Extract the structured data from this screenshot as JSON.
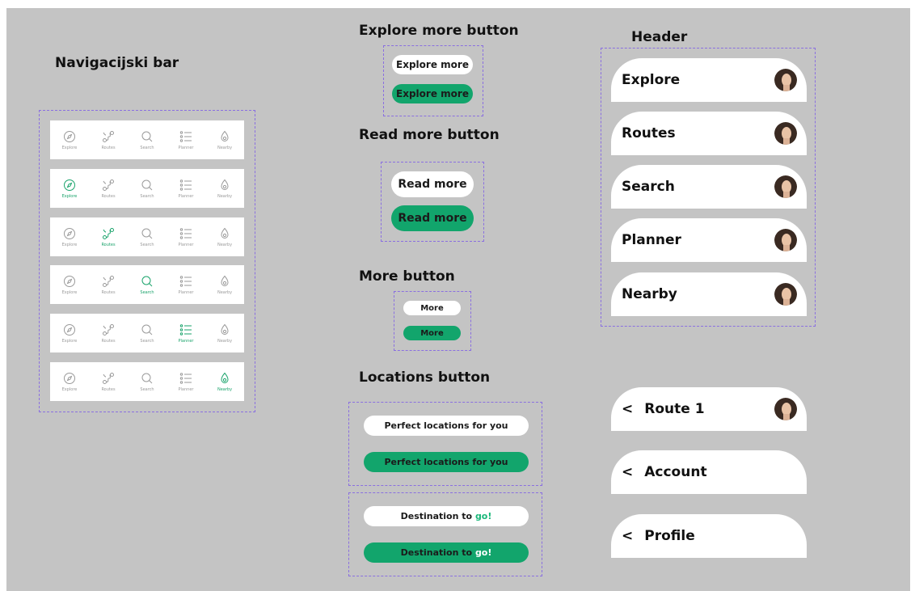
{
  "titles": {
    "nav": "Navigacijski bar",
    "explore": "Explore more button",
    "readmore": "Read more button",
    "more": "More button",
    "locations": "Locations button",
    "header": "Header"
  },
  "nav": {
    "labels": [
      "Explore",
      "Routes",
      "Search",
      "Planner",
      "Nearby"
    ],
    "icons": [
      "compass-icon",
      "route-icon",
      "search-icon",
      "list-icon",
      "location-icon"
    ],
    "active_indices": [
      null,
      0,
      1,
      2,
      3,
      4
    ]
  },
  "buttons": {
    "explore_label": "Explore more",
    "readmore_label": "Read more",
    "more_label": "More",
    "locations_label": "Perfect locations for you",
    "destination_prefix": "Destination to ",
    "destination_go": "go!"
  },
  "headers": [
    "Explore",
    "Routes",
    "Search",
    "Planner",
    "Nearby"
  ],
  "subheaders": [
    {
      "title": "Route 1",
      "back": "<",
      "avatar": true
    },
    {
      "title": "Account",
      "back": "<",
      "avatar": false
    },
    {
      "title": "Profile",
      "back": "<",
      "avatar": false
    }
  ],
  "colors": {
    "background": "#c4c4c4",
    "accent_green": "#12a56c",
    "dashed_border": "#8a6fe0",
    "icon_gray": "#9a9a9a"
  }
}
